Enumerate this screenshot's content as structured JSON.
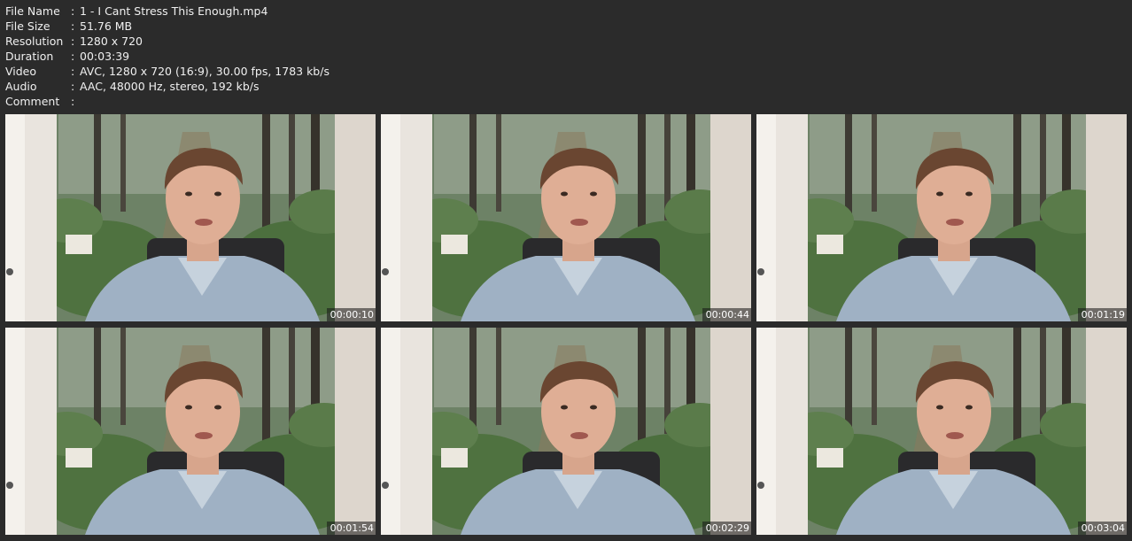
{
  "info": [
    {
      "key": "File Name",
      "sep": ":",
      "value": "1 - I Cant Stress This Enough.mp4"
    },
    {
      "key": "File Size",
      "sep": ":",
      "value": "51.76 MB"
    },
    {
      "key": "Resolution",
      "sep": ":",
      "value": "1280 x 720"
    },
    {
      "key": "Duration",
      "sep": ":",
      "value": "00:03:39"
    },
    {
      "key": "Video",
      "sep": ":",
      "value": "AVC, 1280 x 720 (16:9), 30.00 fps, 1783 kb/s"
    },
    {
      "key": "Audio",
      "sep": ":",
      "value": "AAC, 48000 Hz, stereo, 192 kb/s"
    },
    {
      "key": "Comment",
      "sep": ":",
      "value": ""
    }
  ],
  "thumbnails": [
    {
      "timestamp": "00:00:10"
    },
    {
      "timestamp": "00:00:44"
    },
    {
      "timestamp": "00:01:19"
    },
    {
      "timestamp": "00:01:54"
    },
    {
      "timestamp": "00:02:29"
    },
    {
      "timestamp": "00:03:04"
    }
  ],
  "colors": {
    "background": "#2b2b2b",
    "text": "#f0f0f0"
  }
}
